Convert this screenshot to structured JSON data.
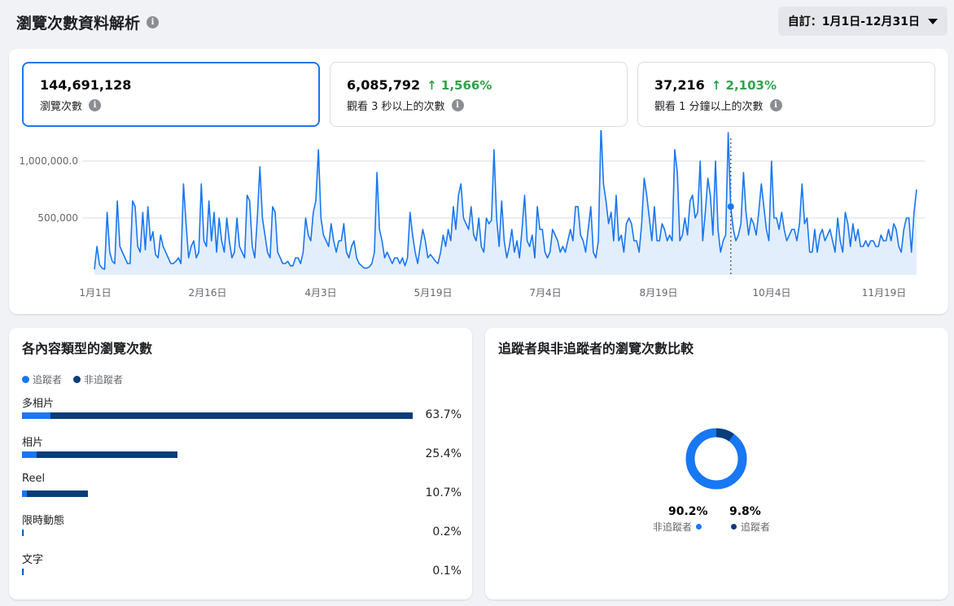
{
  "header": {
    "title": "瀏覽次數資料解析",
    "date_range": "自訂：1月1日-12月31日"
  },
  "metrics": [
    {
      "value": "144,691,128",
      "change": "",
      "label": "瀏覽次數"
    },
    {
      "value": "6,085,792",
      "change": "↑ 1,566%",
      "label": "觀看 3 秒以上的次數"
    },
    {
      "value": "37,216",
      "change": "↑ 2,103%",
      "label": "觀看 1 分鐘以上的次數"
    }
  ],
  "chart_data": {
    "type": "area",
    "y_ticks": [
      "1,000,000.0",
      "500,000"
    ],
    "x_ticks": [
      "1月1日",
      "2月16日",
      "4月3日",
      "5月19日",
      "7月4日",
      "8月19日",
      "10月4日",
      "11月19日"
    ],
    "ylim": [
      0,
      1200000
    ],
    "grid": true,
    "highlight_day": 250,
    "values": [
      50000,
      250000,
      90000,
      60000,
      50000,
      550000,
      200000,
      120000,
      100000,
      650000,
      250000,
      200000,
      150000,
      100000,
      100000,
      650000,
      600000,
      250000,
      200000,
      550000,
      220000,
      600000,
      300000,
      380000,
      180000,
      150000,
      350000,
      250000,
      200000,
      150000,
      100000,
      100000,
      120000,
      150000,
      100000,
      800000,
      450000,
      150000,
      250000,
      300000,
      150000,
      200000,
      800000,
      300000,
      250000,
      650000,
      300000,
      550000,
      200000,
      500000,
      300000,
      200000,
      500000,
      300000,
      150000,
      200000,
      500000,
      250000,
      200000,
      150000,
      700000,
      650000,
      250000,
      150000,
      500000,
      950000,
      500000,
      350000,
      200000,
      150000,
      600000,
      550000,
      200000,
      150000,
      100000,
      100000,
      120000,
      80000,
      80000,
      150000,
      150000,
      100000,
      200000,
      500000,
      350000,
      300000,
      550000,
      650000,
      1100000,
      500000,
      350000,
      300000,
      250000,
      450000,
      300000,
      200000,
      300000,
      300000,
      450000,
      200000,
      150000,
      250000,
      300000,
      150000,
      100000,
      80000,
      60000,
      60000,
      70000,
      100000,
      200000,
      900000,
      400000,
      300000,
      150000,
      200000,
      150000,
      100000,
      150000,
      150000,
      100000,
      150000,
      80000,
      150000,
      550000,
      350000,
      200000,
      100000,
      250000,
      400000,
      300000,
      150000,
      180000,
      150000,
      120000,
      100000,
      200000,
      350000,
      250000,
      400000,
      300000,
      600000,
      400000,
      700000,
      800000,
      500000,
      450000,
      400000,
      600000,
      350000,
      300000,
      500000,
      250000,
      200000,
      500000,
      450000,
      480000,
      1100000,
      500000,
      250000,
      650000,
      300000,
      150000,
      250000,
      400000,
      200000,
      300000,
      150000,
      400000,
      700000,
      300000,
      250000,
      350000,
      150000,
      600000,
      400000,
      400000,
      200000,
      150000,
      200000,
      400000,
      350000,
      300000,
      200000,
      250000,
      200000,
      300000,
      400000,
      300000,
      600000,
      600000,
      350000,
      300000,
      200000,
      400000,
      600000,
      200000,
      150000,
      300000,
      1300000,
      800000,
      650000,
      450000,
      550000,
      300000,
      700000,
      300000,
      350000,
      200000,
      450000,
      500000,
      450000,
      300000,
      300000,
      200000,
      450000,
      850000,
      700000,
      500000,
      300000,
      600000,
      300000,
      300000,
      450000,
      400000,
      300000,
      350000,
      300000,
      1100000,
      900000,
      300000,
      350000,
      500000,
      350000,
      650000,
      700000,
      500000,
      550000,
      1000000,
      300000,
      550000,
      850000,
      700000,
      350000,
      1000000,
      400000,
      200000,
      300000,
      350000,
      1250000,
      600000,
      400000,
      300000,
      350000,
      450000,
      900000,
      550000,
      350000,
      500000,
      450000,
      350000,
      550000,
      800000,
      600000,
      400000,
      300000,
      1000000,
      500000,
      500000,
      400000,
      550000,
      400000,
      300000,
      350000,
      400000,
      400000,
      300000,
      450000,
      800000,
      450000,
      500000,
      200000,
      200000,
      400000,
      200000,
      350000,
      400000,
      300000,
      350000,
      400000,
      300000,
      200000,
      500000,
      300000,
      200000,
      550000,
      450000,
      250000,
      450000,
      300000,
      400000,
      250000,
      250000,
      300000,
      250000,
      300000,
      300000,
      250000,
      250000,
      350000,
      300000,
      300000,
      400000,
      300000,
      450000,
      400000,
      250000,
      200000,
      400000,
      500000,
      500000,
      200000,
      550000,
      750000
    ]
  },
  "content_types": {
    "title": "各內容類型的瀏覽次數",
    "legend_follower": "追蹤者",
    "legend_non_follower": "非追蹤者",
    "rows": [
      {
        "label": "多相片",
        "pct": "63.7%",
        "total": 63.7,
        "follower": 4.6
      },
      {
        "label": "相片",
        "pct": "25.4%",
        "total": 25.4,
        "follower": 2.4
      },
      {
        "label": "Reel",
        "pct": "10.7%",
        "total": 10.7,
        "follower": 0.8
      },
      {
        "label": "限時動態",
        "pct": "0.2%",
        "total": 0.2,
        "follower": 0.1
      },
      {
        "label": "文字",
        "pct": "0.1%",
        "total": 0.1,
        "follower": 0.05
      }
    ]
  },
  "comparison": {
    "title": "追蹤者與非追蹤者的瀏覽次數比較",
    "non_follower_pct": "90.2%",
    "non_follower_label": "非追蹤者",
    "follower_pct": "9.8%",
    "follower_label": "追蹤者",
    "non_follower_share": 90.2,
    "follower_share": 9.8
  },
  "colors": {
    "accent": "#1877f2",
    "follower": "#1877f2",
    "non_follower": "#0a3d7a",
    "positive": "#31a24c"
  }
}
